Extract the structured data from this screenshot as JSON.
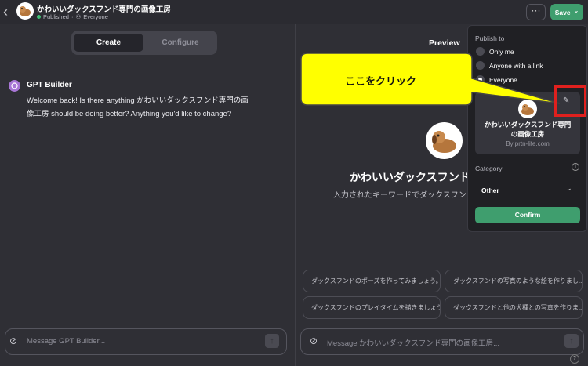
{
  "header": {
    "title": "かわいいダックスフンド専門の画像工房",
    "status": "Published",
    "separator": "·",
    "visibility": "Everyone",
    "more_label": "···",
    "save_label": "Save",
    "save_chevron": "⌄"
  },
  "tabs": {
    "create": "Create",
    "configure": "Configure"
  },
  "chat": {
    "builder_name": "GPT Builder",
    "message": "Welcome back! Is there anything かわいいダックスフンド専門の画像工房 should be doing better? Anything you'd like to change?",
    "input_placeholder": "Message GPT Builder..."
  },
  "preview": {
    "title": "Preview",
    "gpt_name": "かわいいダックスフンド専",
    "gpt_desc": "入力されたキーワードでダックスフント",
    "starters": [
      "ダックスフンドのポーズを作ってみましょう。",
      "ダックスフンドの写真のような絵を作りまし...",
      "ダックスフンドのプレイタイムを描きましょう。",
      "ダックスフンドと他の犬種との写真を作りま..."
    ],
    "input_placeholder": "Message かわいいダックスフンド専門の画像工房..."
  },
  "publish": {
    "label": "Publish to",
    "options": [
      "Only me",
      "Anyone with a link",
      "Everyone"
    ],
    "selected": "Everyone",
    "card_name": "かわいいダックスフンド専門の画像工房",
    "card_by": "By ",
    "card_by_link": "prtn-life.com",
    "category_label": "Category",
    "category_value": "Other",
    "confirm_label": "Confirm"
  },
  "annotation": {
    "text": "ここをクリック",
    "color": "#ffff00",
    "box_color": "#e0201e"
  },
  "colors": {
    "accent": "#3f9e6e",
    "background": "#2f2f35",
    "dropdown": "#202024"
  }
}
